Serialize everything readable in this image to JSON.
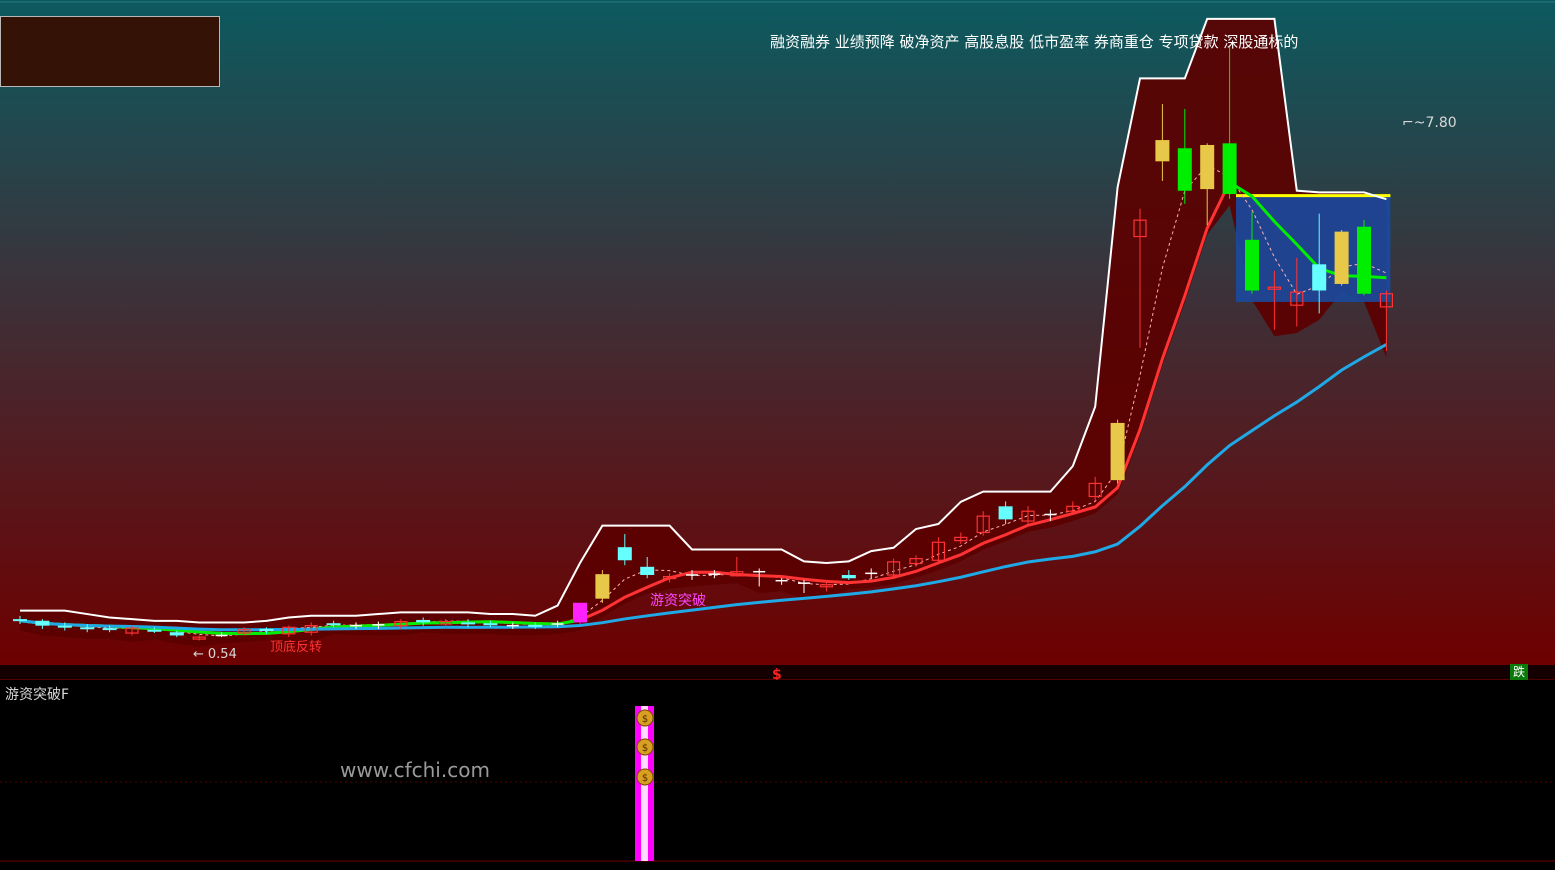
{
  "header": {
    "tags": "融资融券 业绩预降 破净资产 高股息股 低市盈率 券商重仓 专项贷款 深股通标的"
  },
  "indicator": {
    "title": "游资突破F",
    "watermark": "www.cfchi.com"
  },
  "annotations": {
    "high_price": "7.80",
    "low_price": "0.54",
    "breakout": "游资突破",
    "reversal": "顶底反转",
    "dollar_marker": "$",
    "down_badge": "跌"
  },
  "colors": {
    "bg_top": "#0c5a5f",
    "bg_bottom": "#6e0000",
    "band": "#5c0000",
    "up": "#ff3333",
    "down_cyan": "#66ffff",
    "green": "#00ee00",
    "blue": "#1fa9e6",
    "yellow": "#ffff00",
    "magenta": "#ff22ff"
  },
  "chart_data": {
    "type": "candlestick",
    "price_range": [
      0.3,
      8.3
    ],
    "candles": [
      {
        "i": 0,
        "o": 0.8,
        "h": 0.84,
        "l": 0.74,
        "c": 0.78,
        "k": "cyan"
      },
      {
        "i": 1,
        "o": 0.78,
        "h": 0.8,
        "l": 0.68,
        "c": 0.72,
        "k": "cyan"
      },
      {
        "i": 2,
        "o": 0.72,
        "h": 0.76,
        "l": 0.66,
        "c": 0.7,
        "k": "cyan"
      },
      {
        "i": 3,
        "o": 0.7,
        "h": 0.74,
        "l": 0.64,
        "c": 0.69,
        "k": "cyan"
      },
      {
        "i": 4,
        "o": 0.69,
        "h": 0.72,
        "l": 0.64,
        "c": 0.68,
        "k": "cyan"
      },
      {
        "i": 5,
        "o": 0.63,
        "h": 0.72,
        "l": 0.6,
        "c": 0.69,
        "k": "red"
      },
      {
        "i": 6,
        "o": 0.67,
        "h": 0.7,
        "l": 0.63,
        "c": 0.66,
        "k": "cyan"
      },
      {
        "i": 7,
        "o": 0.64,
        "h": 0.66,
        "l": 0.58,
        "c": 0.6,
        "k": "cyan"
      },
      {
        "i": 8,
        "o": 0.57,
        "h": 0.6,
        "l": 0.54,
        "c": 0.58,
        "k": "red"
      },
      {
        "i": 9,
        "o": 0.6,
        "h": 0.64,
        "l": 0.58,
        "c": 0.6,
        "k": "cross"
      },
      {
        "i": 10,
        "o": 0.63,
        "h": 0.7,
        "l": 0.6,
        "c": 0.67,
        "k": "red"
      },
      {
        "i": 11,
        "o": 0.66,
        "h": 0.7,
        "l": 0.62,
        "c": 0.68,
        "k": "cyan"
      },
      {
        "i": 12,
        "o": 0.62,
        "h": 0.72,
        "l": 0.58,
        "c": 0.7,
        "k": "red"
      },
      {
        "i": 13,
        "o": 0.64,
        "h": 0.76,
        "l": 0.6,
        "c": 0.72,
        "k": "red"
      },
      {
        "i": 14,
        "o": 0.74,
        "h": 0.78,
        "l": 0.7,
        "c": 0.75,
        "k": "cyan"
      },
      {
        "i": 15,
        "o": 0.72,
        "h": 0.76,
        "l": 0.68,
        "c": 0.72,
        "k": "cross"
      },
      {
        "i": 16,
        "o": 0.72,
        "h": 0.77,
        "l": 0.68,
        "c": 0.73,
        "k": "cross"
      },
      {
        "i": 17,
        "o": 0.72,
        "h": 0.8,
        "l": 0.68,
        "c": 0.77,
        "k": "red"
      },
      {
        "i": 18,
        "o": 0.76,
        "h": 0.82,
        "l": 0.72,
        "c": 0.79,
        "k": "cyan"
      },
      {
        "i": 19,
        "o": 0.74,
        "h": 0.8,
        "l": 0.7,
        "c": 0.77,
        "k": "red"
      },
      {
        "i": 20,
        "o": 0.76,
        "h": 0.8,
        "l": 0.7,
        "c": 0.76,
        "k": "cyan"
      },
      {
        "i": 21,
        "o": 0.74,
        "h": 0.78,
        "l": 0.7,
        "c": 0.75,
        "k": "cyan"
      },
      {
        "i": 22,
        "o": 0.72,
        "h": 0.76,
        "l": 0.68,
        "c": 0.72,
        "k": "cross"
      },
      {
        "i": 23,
        "o": 0.72,
        "h": 0.76,
        "l": 0.68,
        "c": 0.73,
        "k": "cyan"
      },
      {
        "i": 24,
        "o": 0.73,
        "h": 0.78,
        "l": 0.7,
        "c": 0.74,
        "k": "cross"
      },
      {
        "i": 25,
        "o": 0.76,
        "h": 0.9,
        "l": 0.74,
        "c": 1.0,
        "k": "magenta"
      },
      {
        "i": 26,
        "o": 1.05,
        "h": 1.4,
        "l": 1.0,
        "c": 1.35,
        "k": "gold"
      },
      {
        "i": 27,
        "o": 1.68,
        "h": 1.84,
        "l": 1.46,
        "c": 1.52,
        "k": "cyan"
      },
      {
        "i": 28,
        "o": 1.44,
        "h": 1.56,
        "l": 1.3,
        "c": 1.34,
        "k": "cyan"
      },
      {
        "i": 29,
        "o": 1.31,
        "h": 1.36,
        "l": 1.25,
        "c": 1.32,
        "k": "red"
      },
      {
        "i": 30,
        "o": 1.32,
        "h": 1.4,
        "l": 1.28,
        "c": 1.34,
        "k": "cross"
      },
      {
        "i": 31,
        "o": 1.34,
        "h": 1.4,
        "l": 1.3,
        "c": 1.35,
        "k": "cross"
      },
      {
        "i": 32,
        "o": 1.33,
        "h": 1.56,
        "l": 1.32,
        "c": 1.38,
        "k": "red"
      },
      {
        "i": 33,
        "o": 1.38,
        "h": 1.42,
        "l": 1.2,
        "c": 1.27,
        "k": "cross"
      },
      {
        "i": 34,
        "o": 1.26,
        "h": 1.3,
        "l": 1.22,
        "c": 1.27,
        "k": "cross"
      },
      {
        "i": 35,
        "o": 1.24,
        "h": 1.28,
        "l": 1.12,
        "c": 1.17,
        "k": "cross"
      },
      {
        "i": 36,
        "o": 1.2,
        "h": 1.26,
        "l": 1.14,
        "c": 1.22,
        "k": "red"
      },
      {
        "i": 37,
        "o": 1.34,
        "h": 1.4,
        "l": 1.28,
        "c": 1.3,
        "k": "cyan"
      },
      {
        "i": 38,
        "o": 1.36,
        "h": 1.42,
        "l": 1.3,
        "c": 1.36,
        "k": "cross"
      },
      {
        "i": 39,
        "o": 1.34,
        "h": 1.54,
        "l": 1.32,
        "c": 1.5,
        "k": "red"
      },
      {
        "i": 40,
        "o": 1.48,
        "h": 1.58,
        "l": 1.44,
        "c": 1.54,
        "k": "red"
      },
      {
        "i": 41,
        "o": 1.52,
        "h": 1.8,
        "l": 1.48,
        "c": 1.74,
        "k": "red"
      },
      {
        "i": 42,
        "o": 1.76,
        "h": 1.86,
        "l": 1.72,
        "c": 1.8,
        "k": "red"
      },
      {
        "i": 43,
        "o": 1.86,
        "h": 2.12,
        "l": 1.82,
        "c": 2.06,
        "k": "red"
      },
      {
        "i": 44,
        "o": 2.18,
        "h": 2.24,
        "l": 1.96,
        "c": 2.02,
        "k": "cyan"
      },
      {
        "i": 45,
        "o": 2.0,
        "h": 2.18,
        "l": 1.96,
        "c": 2.12,
        "k": "red"
      },
      {
        "i": 46,
        "o": 2.06,
        "h": 2.14,
        "l": 2.0,
        "c": 2.08,
        "k": "cross"
      },
      {
        "i": 47,
        "o": 2.12,
        "h": 2.24,
        "l": 2.08,
        "c": 2.18,
        "k": "red"
      },
      {
        "i": 48,
        "o": 2.3,
        "h": 2.54,
        "l": 2.24,
        "c": 2.46,
        "k": "red"
      },
      {
        "i": 49,
        "o": 2.5,
        "h": 3.24,
        "l": 2.46,
        "c": 3.2,
        "k": "gold"
      },
      {
        "i": 50,
        "o": 5.48,
        "h": 5.82,
        "l": 4.12,
        "c": 5.68,
        "k": "red"
      },
      {
        "i": 51,
        "o": 6.66,
        "h": 7.1,
        "l": 6.16,
        "c": 6.4,
        "k": "gold"
      },
      {
        "i": 52,
        "o": 6.56,
        "h": 7.04,
        "l": 5.88,
        "c": 6.04,
        "k": "green"
      },
      {
        "i": 53,
        "o": 6.06,
        "h": 6.62,
        "l": 5.62,
        "c": 6.6,
        "k": "gold"
      },
      {
        "i": 54,
        "o": 6.62,
        "h": 7.8,
        "l": 5.94,
        "c": 6.0,
        "k": "green"
      },
      {
        "i": 55,
        "o": 5.44,
        "h": 5.78,
        "l": 4.78,
        "c": 4.82,
        "k": "green"
      },
      {
        "i": 56,
        "o": 4.84,
        "h": 5.06,
        "l": 4.34,
        "c": 4.86,
        "k": "red"
      },
      {
        "i": 57,
        "o": 4.8,
        "h": 5.22,
        "l": 4.38,
        "c": 4.64,
        "k": "red"
      },
      {
        "i": 58,
        "o": 4.82,
        "h": 5.76,
        "l": 4.54,
        "c": 5.14,
        "k": "cyan"
      },
      {
        "i": 59,
        "o": 4.9,
        "h": 5.56,
        "l": 4.88,
        "c": 5.54,
        "k": "gold"
      },
      {
        "i": 60,
        "o": 5.6,
        "h": 5.68,
        "l": 4.76,
        "c": 4.78,
        "k": "green"
      },
      {
        "i": 61,
        "o": 4.62,
        "h": 4.82,
        "l": 4.08,
        "c": 4.78,
        "k": "red"
      }
    ]
  }
}
